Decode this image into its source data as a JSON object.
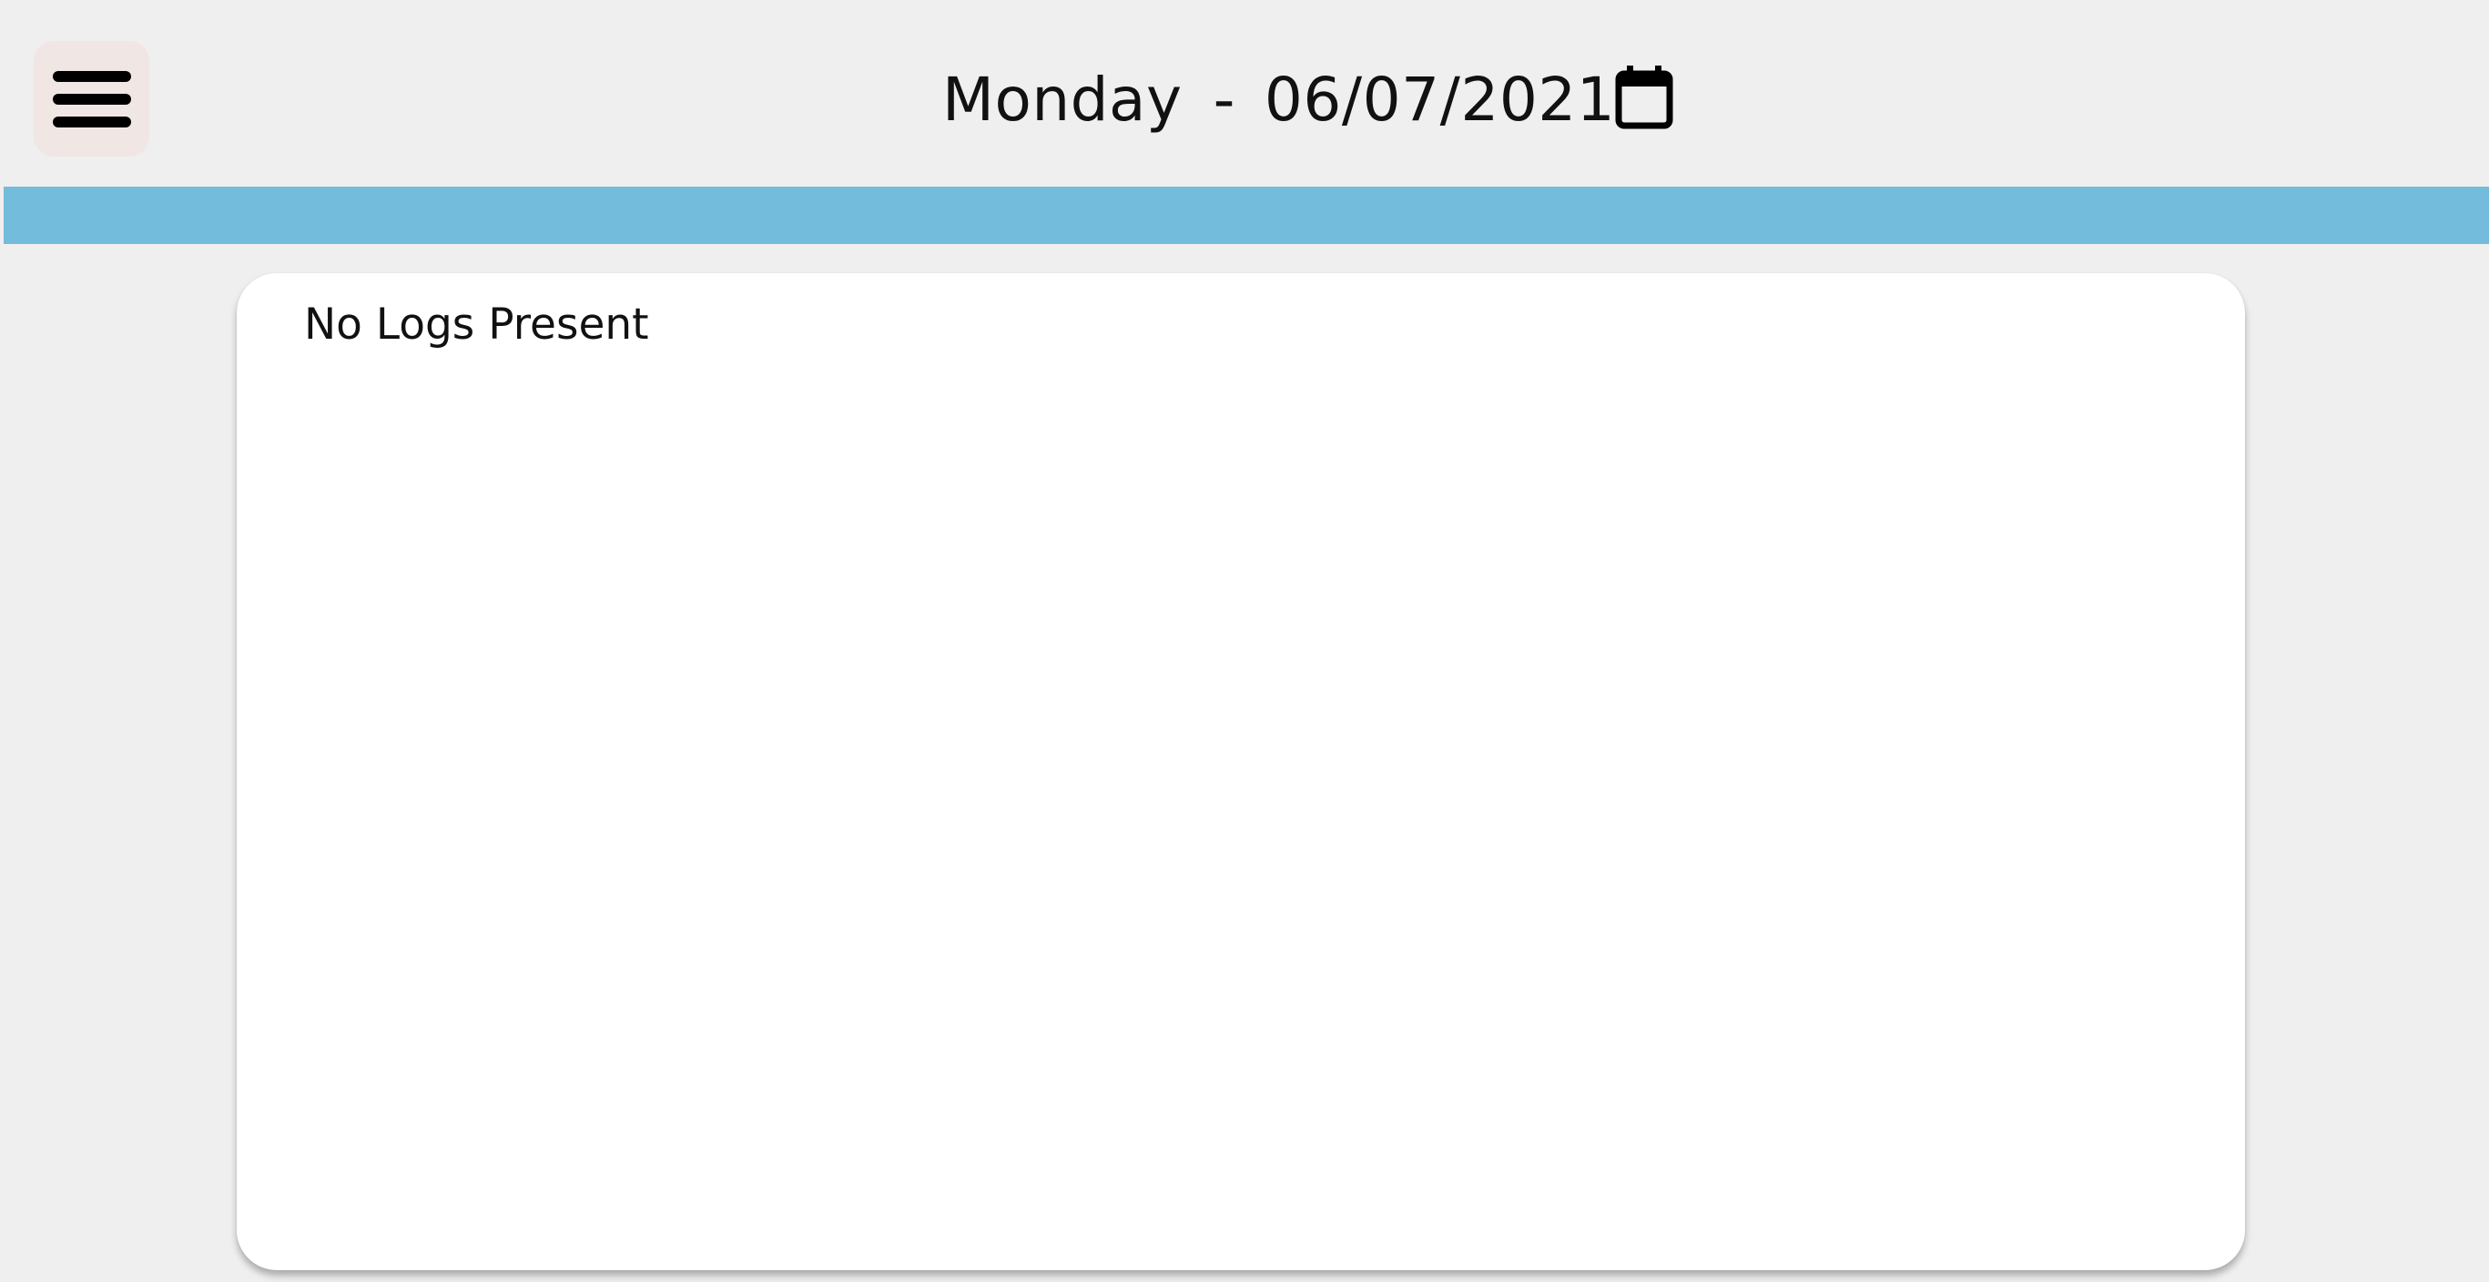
{
  "header": {
    "menu_icon": "hamburger-menu-icon",
    "day": "Monday",
    "separator": "-",
    "date": "06/07/2021",
    "calendar_icon": "calendar-icon"
  },
  "logs": {
    "empty_message": "No Logs Present"
  },
  "colors": {
    "background": "#efefef",
    "menu_button_bg": "#f0e6e3",
    "accent_bar": "#73bcdb",
    "card_bg": "#ffffff",
    "text": "#111111"
  }
}
